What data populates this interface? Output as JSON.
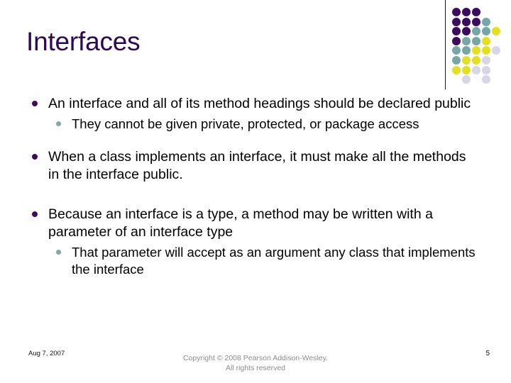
{
  "slide": {
    "title": "Interfaces",
    "title_color": "#2E0854",
    "background_color": "#FFFFFF",
    "body": [
      {
        "level": 1,
        "text": "An interface and all of its method headings should be declared public",
        "bullet_color": "#3B0B60",
        "children": [
          {
            "level": 2,
            "text": "They cannot be given private, protected, or package access",
            "bullet_color": "#7FA8A8"
          }
        ]
      },
      {
        "level": 1,
        "text": "When a class implements an interface, it must make all the methods in the interface public.",
        "bullet_color": "#3B0B60",
        "children": []
      },
      {
        "level": 1,
        "text": "Because an interface is a type, a method may be written with a parameter of an interface type",
        "bullet_color": "#3B0B60",
        "children": [
          {
            "level": 2,
            "text": "That parameter will accept as an argument any class that implements the interface",
            "bullet_color": "#7FA8A8"
          }
        ]
      }
    ]
  },
  "footer": {
    "date": "Aug 7, 2007",
    "copyright_line1": "Copyright © 2008 Pearson Addison-Wesley.",
    "copyright_line2": "All rights reserved",
    "page_number": "5",
    "copyright_color": "#8C8C8C"
  },
  "decoration": {
    "rule_color": "#1A1A1A",
    "palette": {
      "purple": "#3B0B60",
      "teal": "#75A7A7",
      "yellow": "#E3E021",
      "lavender": "#D6D6E6"
    },
    "dot_grid": [
      [
        "purple",
        "purple",
        "purple",
        "empty",
        "empty"
      ],
      [
        "purple",
        "purple",
        "purple",
        "teal",
        "empty"
      ],
      [
        "purple",
        "purple",
        "teal",
        "teal",
        "yellow"
      ],
      [
        "purple",
        "teal",
        "teal",
        "yellow",
        "empty"
      ],
      [
        "teal",
        "teal",
        "yellow",
        "yellow",
        "lavender"
      ],
      [
        "teal",
        "yellow",
        "yellow",
        "lavender",
        "empty"
      ],
      [
        "yellow",
        "yellow",
        "lavender",
        "lavender",
        "empty"
      ],
      [
        "empty",
        "lavender",
        "empty",
        "lavender",
        "empty"
      ]
    ]
  }
}
